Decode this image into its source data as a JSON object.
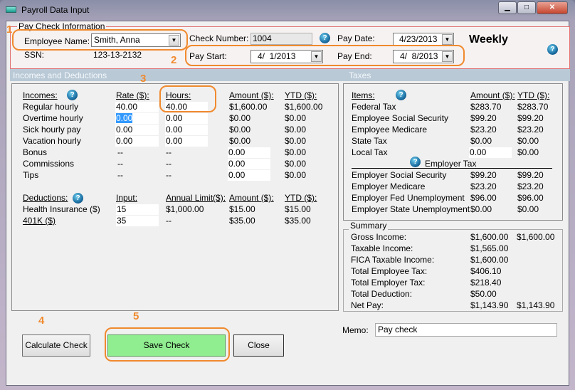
{
  "window": {
    "title": "Payroll Data Input",
    "minimize": "▁",
    "maximize": "□",
    "close": "✕"
  },
  "paycheck": {
    "group_title": "Pay Check Information",
    "employee_label": "Employee Name:",
    "employee_value": "Smith, Anna",
    "ssn_label": "SSN:",
    "ssn_value": "123-13-2132",
    "check_number_label": "Check Number:",
    "check_number_value": "1004",
    "pay_date_label": "Pay Date:",
    "pay_date_value": "4/23/2013",
    "pay_start_label": "Pay Start:",
    "pay_start_value": "4/  1/2013",
    "pay_end_label": "Pay End:",
    "pay_end_value": "4/  8/2013",
    "frequency": "Weekly"
  },
  "sections": {
    "incomes_deductions": "Incomes and Deductions",
    "taxes": "Taxes"
  },
  "incomes": {
    "headers": [
      "Incomes:",
      "Rate ($):",
      "Hours:",
      "Amount ($):",
      "YTD ($):"
    ],
    "rows": [
      {
        "label": "Regular hourly",
        "rate": "40.00",
        "hours": "40.00",
        "amount": "$1,600.00",
        "ytd": "$1,600.00"
      },
      {
        "label": "Overtime hourly",
        "rate": "0.00",
        "hours": "0.00",
        "amount": "$0.00",
        "ytd": "$0.00"
      },
      {
        "label": "Sick hourly pay",
        "rate": "0.00",
        "hours": "0.00",
        "amount": "$0.00",
        "ytd": "$0.00"
      },
      {
        "label": "Vacation hourly",
        "rate": "0.00",
        "hours": "0.00",
        "amount": "$0.00",
        "ytd": "$0.00"
      },
      {
        "label": "Bonus",
        "rate": "--",
        "hours": "--",
        "amount": "0.00",
        "ytd": "$0.00"
      },
      {
        "label": "Commissions",
        "rate": "--",
        "hours": "--",
        "amount": "0.00",
        "ytd": "$0.00"
      },
      {
        "label": "Tips",
        "rate": "--",
        "hours": "--",
        "amount": "0.00",
        "ytd": "$0.00"
      }
    ]
  },
  "deductions": {
    "headers": [
      "Deductions:",
      "Input:",
      "Annual Limit($):",
      "Amount ($):",
      "YTD ($):"
    ],
    "rows": [
      {
        "label": "Health Insurance  ($)",
        "input": "15",
        "limit": "$1,000.00",
        "amount": "$15.00",
        "ytd": "$15.00"
      },
      {
        "label": "401K  ($)",
        "input": "35",
        "limit": "--",
        "amount": "$35.00",
        "ytd": "$35.00"
      }
    ]
  },
  "taxes": {
    "headers": [
      "Items:",
      "Amount ($):",
      "YTD ($):"
    ],
    "employee_rows": [
      {
        "label": "Federal Tax",
        "amount": "$283.70",
        "ytd": "$283.70"
      },
      {
        "label": "Employee Social Security",
        "amount": "$99.20",
        "ytd": "$99.20"
      },
      {
        "label": "Employee Medicare",
        "amount": "$23.20",
        "ytd": "$23.20"
      },
      {
        "label": "State Tax",
        "amount": "$0.00",
        "ytd": "$0.00"
      },
      {
        "label": "Local Tax",
        "amount": "0.00",
        "ytd": "$0.00"
      }
    ],
    "employer_title": "Employer Tax",
    "employer_rows": [
      {
        "label": "Employer Social Security",
        "amount": "$99.20",
        "ytd": "$99.20"
      },
      {
        "label": "Employer Medicare",
        "amount": "$23.20",
        "ytd": "$23.20"
      },
      {
        "label": "Employer Fed Unemployment",
        "amount": "$96.00",
        "ytd": "$96.00"
      },
      {
        "label": "Employer State Unemployment",
        "amount": "$0.00",
        "ytd": "$0.00"
      }
    ]
  },
  "summary": {
    "title": "Summary",
    "rows": [
      {
        "label": "Gross Income:",
        "amount": "$1,600.00",
        "ytd": "$1,600.00"
      },
      {
        "label": "Taxable Income:",
        "amount": "$1,565.00",
        "ytd": ""
      },
      {
        "label": "FICA Taxable Income:",
        "amount": "$1,600.00",
        "ytd": ""
      },
      {
        "label": "Total Employee Tax:",
        "amount": "$406.10",
        "ytd": ""
      },
      {
        "label": "Total Employer Tax:",
        "amount": "$218.40",
        "ytd": ""
      },
      {
        "label": "Total Deduction:",
        "amount": "$50.00",
        "ytd": ""
      },
      {
        "label": "Net Pay:",
        "amount": "$1,143.90",
        "ytd": "$1,143.90"
      }
    ]
  },
  "buttons": {
    "calculate": "Calculate Check",
    "save": "Save Check",
    "close": "Close"
  },
  "memo": {
    "label": "Memo:",
    "value": "Pay check"
  },
  "annotations": [
    "1",
    "2",
    "3",
    "4",
    "5"
  ],
  "colors": {
    "annotation": "#f08a2e",
    "save_button": "#90ee90",
    "section_bar": "#b9c9d6",
    "group_border": "#e07070"
  }
}
